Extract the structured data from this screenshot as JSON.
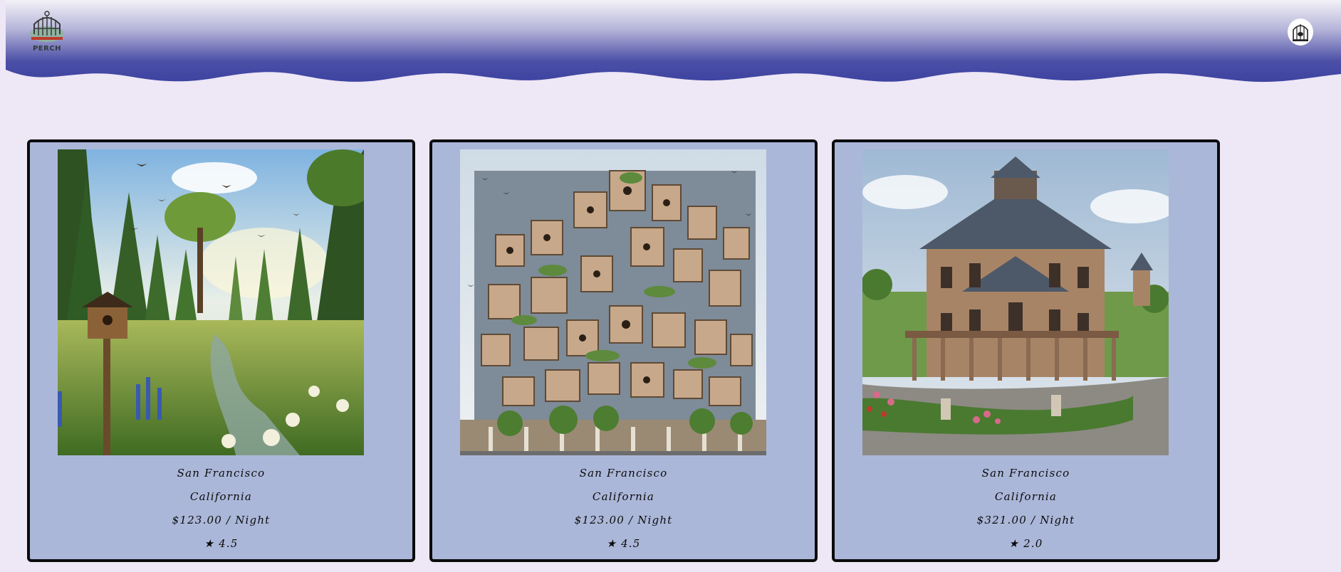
{
  "header": {
    "logo_alt": "Perch logo",
    "logo_text": "PERCH",
    "logo_icon": "birdcage-icon",
    "avatar_icon": "birdcage-avatar-icon"
  },
  "colors": {
    "page_bg": "#ede7f6",
    "header_top": "#f3f1f7",
    "header_bottom": "#3d43a0",
    "card_bg": "#abb7d9",
    "card_border": "#0b0b0b"
  },
  "listings": [
    {
      "city": "San Francisco",
      "state": "California",
      "price": "$123.00 / Night",
      "rating": "★ 4.5",
      "image": "birdhouse-in-meadow"
    },
    {
      "city": "San Francisco",
      "state": "California",
      "price": "$123.00 / Night",
      "rating": "★ 4.5",
      "image": "modular-birdhouse-tower"
    },
    {
      "city": "San Francisco",
      "state": "California",
      "price": "$321.00 / Night",
      "rating": "★ 2.0",
      "image": "victorian-mansion"
    }
  ]
}
